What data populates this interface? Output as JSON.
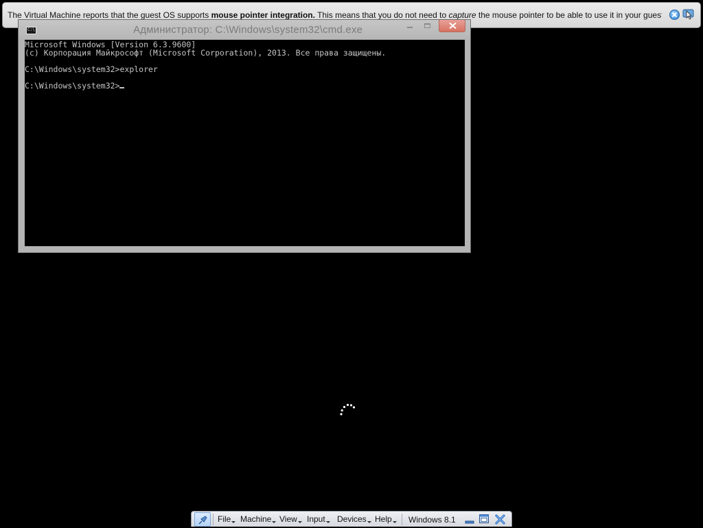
{
  "banner": {
    "text_part1": "The Virtual Machine reports that the guest OS supports ",
    "text_bold": "mouse pointer integration.",
    "text_part2": " This means that you do not need to ",
    "text_italic": "capture",
    "text_part3": " the mouse pointer to be able to use it in your guest OS -- all mouse",
    "close_icon": "close-circle-icon",
    "mouse_icon": "mouse-integration-icon"
  },
  "window": {
    "title": "Администратор: C:\\Windows\\system32\\cmd.exe",
    "app_icon_text": "C:\\",
    "minimize_icon": "minimize-icon",
    "maximize_icon": "maximize-icon",
    "close_icon": "close-icon"
  },
  "console": {
    "lines": [
      "Microsoft Windows [Version 6.3.9600]",
      "(c) Корпорация Майкрософт (Microsoft Corporation), 2013. Все права защищены.",
      "",
      "C:\\Windows\\system32>explorer",
      "",
      "C:\\Windows\\system32>"
    ]
  },
  "spinner": {
    "icon": "loading-spinner-icon",
    "color": "#ffffff"
  },
  "minibar": {
    "pin_icon": "pin-icon",
    "menus": [
      "File",
      "Machine",
      "View",
      "Input",
      "Devices",
      "Help"
    ],
    "vm_name": "Windows 8.1",
    "icons": [
      "minimize-window-icon",
      "restore-window-icon",
      "close-vm-icon"
    ]
  },
  "colors": {
    "console_text": "#c6c6c6",
    "window_frame": "#b4b4b4",
    "close_button": "#d87262",
    "banner_bg": "#e2e2e2"
  }
}
